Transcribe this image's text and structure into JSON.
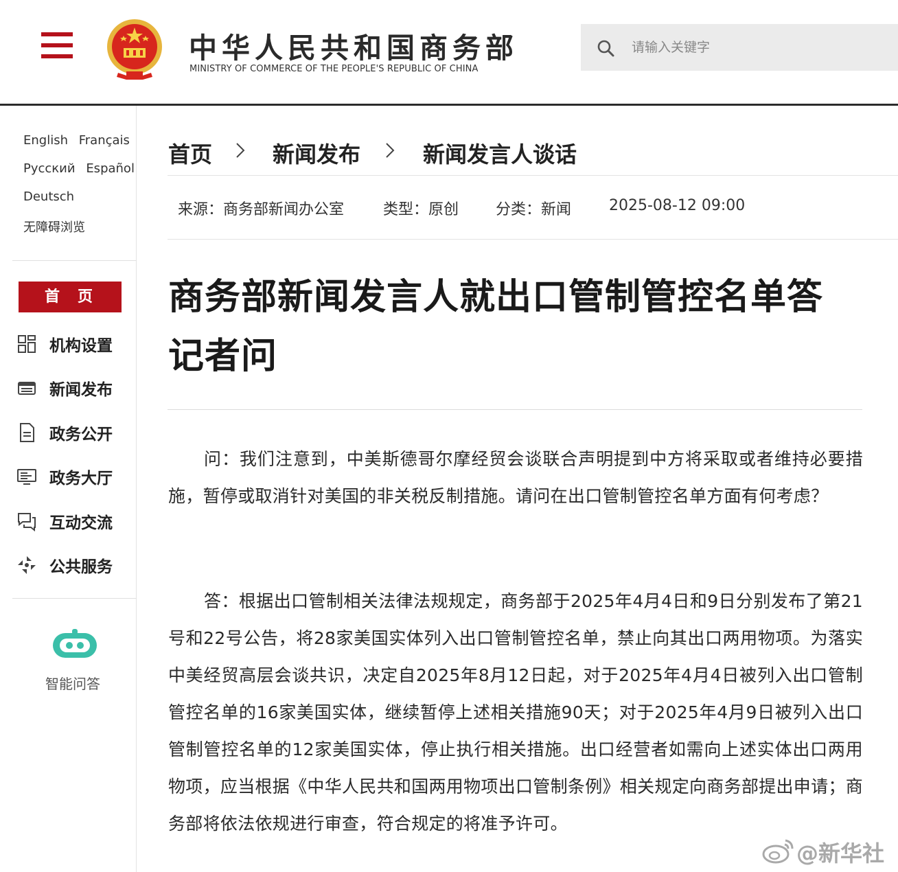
{
  "colors": {
    "brand_red": "#b5121b",
    "text_dark": "#222222",
    "search_bg": "#ebebeb"
  },
  "header": {
    "menu_icon": "hamburger-menu-icon",
    "emblem": "national-emblem-icon",
    "title_cn": "中华人民共和国商务部",
    "title_en": "MINISTRY OF COMMERCE OF THE PEOPLE'S REPUBLIC OF CHINA",
    "search": {
      "placeholder": "请输入关键字",
      "value": "",
      "icon": "search-icon"
    }
  },
  "sidebar": {
    "languages": [
      [
        "English",
        "Français"
      ],
      [
        "Русский",
        "Español"
      ],
      [
        "Deutsch"
      ],
      [
        "无障碍浏览"
      ]
    ],
    "home_label": "首页",
    "nav": [
      {
        "label": "机构设置",
        "icon": "org-structure-icon"
      },
      {
        "label": "新闻发布",
        "icon": "news-icon"
      },
      {
        "label": "政务公开",
        "icon": "document-icon"
      },
      {
        "label": "政务大厅",
        "icon": "service-hall-icon"
      },
      {
        "label": "互动交流",
        "icon": "chat-icon"
      },
      {
        "label": "公共服务",
        "icon": "public-service-icon"
      }
    ],
    "ai": {
      "label": "智能问答",
      "icon": "robot-icon"
    }
  },
  "breadcrumb": [
    "首页",
    "新闻发布",
    "新闻发言人谈话"
  ],
  "meta": {
    "source": "来源：商务部新闻办公室",
    "type": "类型：原创",
    "category": "分类：新闻",
    "date": "2025-08-12 09:00"
  },
  "article": {
    "title": "商务部新闻发言人就出口管制管控名单答记者问",
    "question": "问：我们注意到，中美斯德哥尔摩经贸会谈联合声明提到中方将采取或者维持必要措施，暂停或取消针对美国的非关税反制措施。请问在出口管制管控名单方面有何考虑？",
    "answer": "答：根据出口管制相关法律法规规定，商务部于2025年4月4日和9日分别发布了第21号和22号公告，将28家美国实体列入出口管制管控名单，禁止向其出口两用物项。为落实中美经贸高层会谈共识，决定自2025年8月12日起，对于2025年4月4日被列入出口管制管控名单的16家美国实体，继续暂停上述相关措施90天；对于2025年4月9日被列入出口管制管控名单的12家美国实体，停止执行相关措施。出口经营者如需向上述实体出口两用物项，应当根据《中华人民共和国两用物项出口管制条例》相关规定向商务部提出申请；商务部将依法依规进行审查，符合规定的将准予许可。"
  },
  "watermark": {
    "text": "@新华社",
    "icon": "weibo-logo-icon"
  }
}
